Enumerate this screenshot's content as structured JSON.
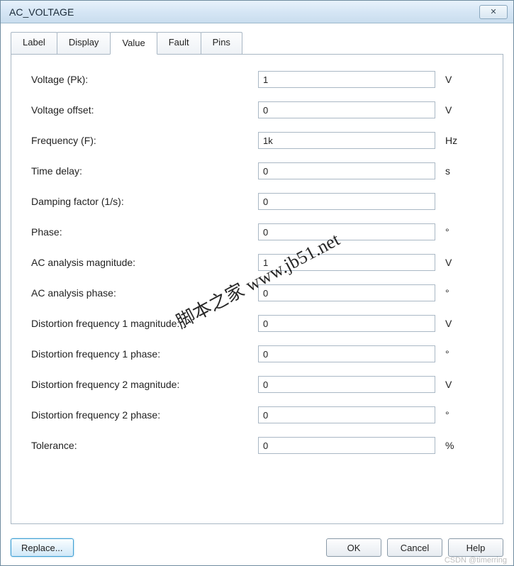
{
  "window": {
    "title": "AC_VOLTAGE",
    "close_glyph": "✕"
  },
  "tabs": [
    {
      "label": "Label"
    },
    {
      "label": "Display"
    },
    {
      "label": "Value"
    },
    {
      "label": "Fault"
    },
    {
      "label": "Pins"
    }
  ],
  "fields": [
    {
      "label": "Voltage (Pk):",
      "value": "1",
      "unit": "V"
    },
    {
      "label": "Voltage offset:",
      "value": "0",
      "unit": "V"
    },
    {
      "label": "Frequency (F):",
      "value": "1k",
      "unit": "Hz"
    },
    {
      "label": "Time delay:",
      "value": "0",
      "unit": "s"
    },
    {
      "label": "Damping factor (1/s):",
      "value": "0",
      "unit": ""
    },
    {
      "label": "Phase:",
      "value": "0",
      "unit": "°"
    },
    {
      "label": "AC analysis magnitude:",
      "value": "1",
      "unit": "V"
    },
    {
      "label": "AC analysis phase:",
      "value": "0",
      "unit": "°"
    },
    {
      "label": "Distortion frequency 1 magnitude:",
      "value": "0",
      "unit": "V"
    },
    {
      "label": "Distortion frequency 1 phase:",
      "value": "0",
      "unit": "°"
    },
    {
      "label": "Distortion frequency 2 magnitude:",
      "value": "0",
      "unit": "V"
    },
    {
      "label": "Distortion frequency 2 phase:",
      "value": "0",
      "unit": "°"
    },
    {
      "label": "Tolerance:",
      "value": "0",
      "unit": "%"
    }
  ],
  "buttons": {
    "replace": "Replace...",
    "ok": "OK",
    "cancel": "Cancel",
    "help": "Help"
  },
  "watermark": "脚本之家 www.jb51.net",
  "footer_credit": "CSDN @timerring"
}
